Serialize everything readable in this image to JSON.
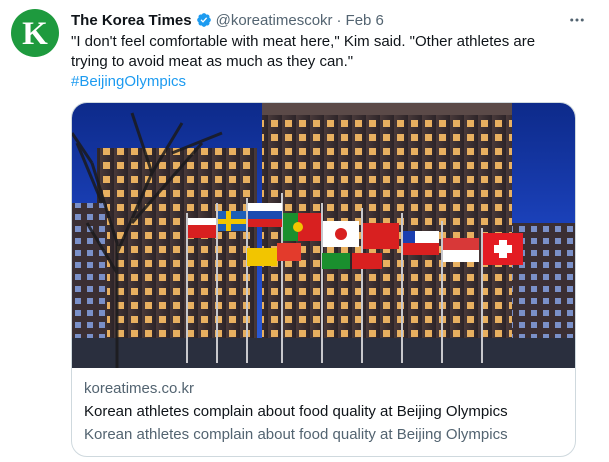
{
  "tweet": {
    "avatar_letter": "K",
    "display_name": "The Korea Times",
    "handle": "@koreatimescokr",
    "separator": "·",
    "date": "Feb 6",
    "text": "\"I don't feel comfortable with meat here,\" Kim said. \"Other athletes are trying to avoid meat as much as they can.\"",
    "hashtag": "#BeijingOlympics"
  },
  "card": {
    "domain": "koreatimes.co.kr",
    "title": "Korean athletes complain about food quality at Beijing Olympics",
    "description": "Korean athletes complain about food quality at Beijing Olympics"
  },
  "icons": {
    "verified": "verified-badge-icon",
    "more": "more-options-icon"
  },
  "colors": {
    "brand_green": "#1e9a3e",
    "link_blue": "#1d9bf0",
    "secondary_text": "#536471",
    "border": "#cfd9de"
  }
}
